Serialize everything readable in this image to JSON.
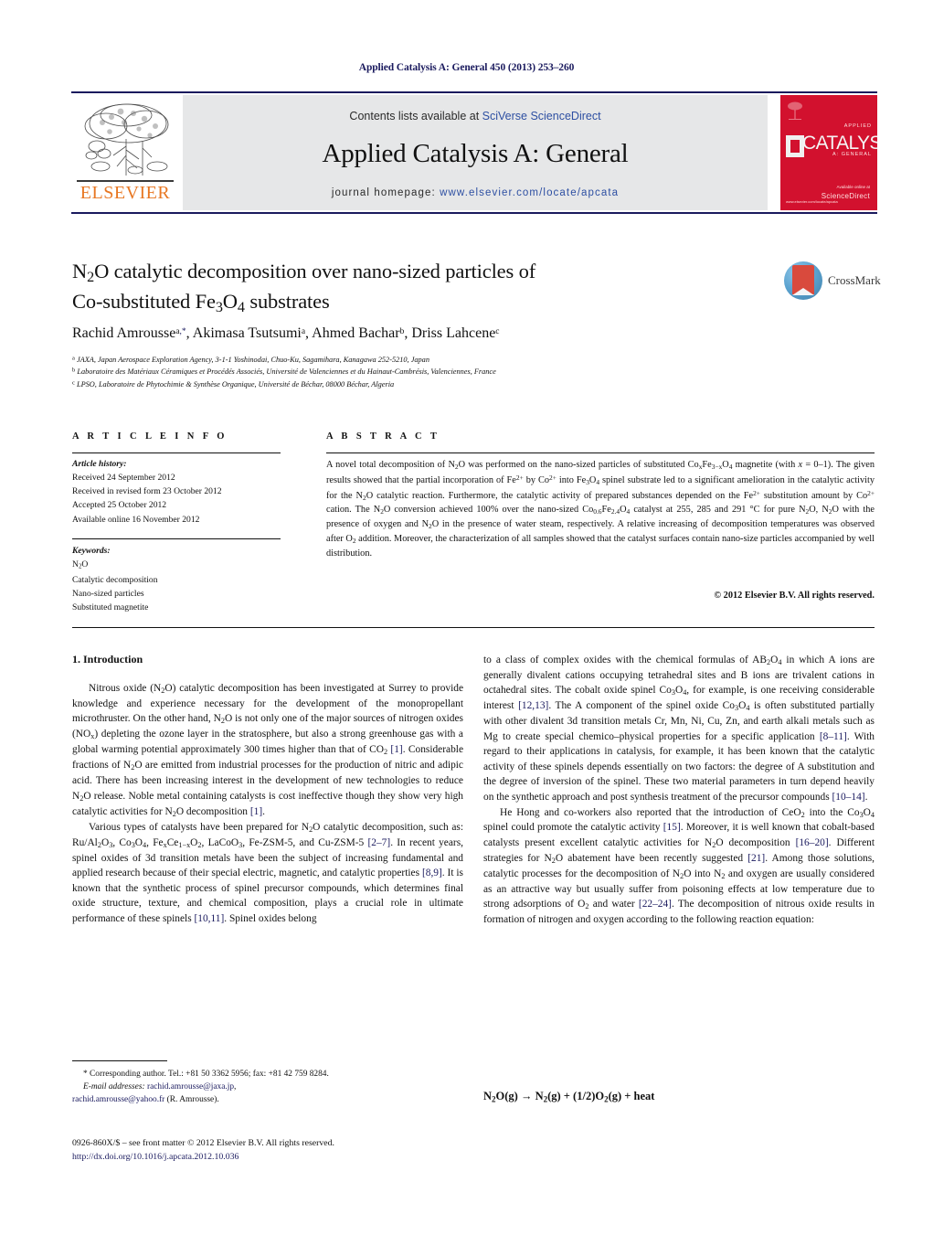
{
  "running_head": "Applied Catalysis A: General 450 (2013) 253–260",
  "masthead": {
    "contents_prefix": "Contents lists available at ",
    "contents_link": "SciVerse ScienceDirect",
    "journal_title": "Applied Catalysis A: General",
    "homepage_prefix": "journal homepage: ",
    "homepage_url": "www.elsevier.com/locate/apcata",
    "publisher_logo_text": "ELSEVIER",
    "cover": {
      "title": "CATALYSIS",
      "sup_top": "APPLIED",
      "sup_bottom": "A: GENERAL",
      "brand_big": "ScienceDirect",
      "brand_small": "Available online at",
      "footer": "www.elsevier.com/locate/apcata"
    }
  },
  "article": {
    "title_line1": "N2O catalytic decomposition over nano-sized particles of",
    "title_line2": "Co-substituted Fe3O4 substrates",
    "authors_plain": "Rachid Amrousse a,*, Akimasa Tsutsumi a, Ahmed Bachar b, Driss Lahcene c",
    "affiliations": [
      {
        "marker": "a",
        "text": "JAXA, Japan Aerospace Exploration Agency, 3-1-1 Yoshinodai, Chuo-Ku, Sagamihara, Kanagawa 252-5210, Japan"
      },
      {
        "marker": "b",
        "text": "Laboratoire des Matériaux Céramiques et Procédés Associés, Université de Valenciennes et du Hainaut-Cambrésis, Valenciennes, France"
      },
      {
        "marker": "c",
        "text": "LPSO, Laboratoire de Phytochimie & Synthèse Organique, Université de Béchar, 08000 Béchar, Algeria"
      }
    ],
    "crossmark_label": "CrossMark"
  },
  "article_info": {
    "heading": "A R T I C L E   I N F O",
    "history_label": "Article history:",
    "history": [
      "Received 24 September 2012",
      "Received in revised form 23 October 2012",
      "Accepted 25 October 2012",
      "Available online 16 November 2012"
    ],
    "keywords_label": "Keywords:",
    "keywords": [
      "N2O",
      "Catalytic decomposition",
      "Nano-sized particles",
      "Substituted magnetite"
    ]
  },
  "abstract": {
    "heading": "A B S T R A C T",
    "text": "A novel total decomposition of N2O was performed on the nano-sized particles of substituted CoxFe3−xO4 magnetite (with x = 0–1). The given results showed that the partial incorporation of Fe2+ by Co2+ into Fe3O4 spinel substrate led to a significant amelioration in the catalytic activity for the N2O catalytic reaction. Furthermore, the catalytic activity of prepared substances depended on the Fe2+ substitution amount by Co2+ cation. The N2O conversion achieved 100% over the nano-sized Co0.6Fe2.4O4 catalyst at 255, 285 and 291 °C for pure N2O, N2O with the presence of oxygen and N2O in the presence of water steam, respectively. A relative increasing of decomposition temperatures was observed after O2 addition. Moreover, the characterization of all samples showed that the catalyst surfaces contain nano-size particles accompanied by well distribution.",
    "copyright": "© 2012 Elsevier B.V. All rights reserved."
  },
  "body": {
    "intro_heading": "1. Introduction",
    "left_paragraphs": [
      "Nitrous oxide (N2O) catalytic decomposition has been investigated at Surrey to provide knowledge and experience necessary for the development of the monopropellant microthruster. On the other hand, N2O is not only one of the major sources of nitrogen oxides (NOx) depleting the ozone layer in the stratosphere, but also a strong greenhouse gas with a global warming potential approximately 300 times higher than that of CO2 [1]. Considerable fractions of N2O are emitted from industrial processes for the production of nitric and adipic acid. There has been increasing interest in the development of new technologies to reduce N2O release. Noble metal containing catalysts is cost ineffective though they show very high catalytic activities for N2O decomposition [1].",
      "Various types of catalysts have been prepared for N2O catalytic decomposition, such as: Ru/Al2O3, Co3O4, FexCe1−xO2, LaCoO3, Fe-ZSM-5, and Cu-ZSM-5 [2–7]. In recent years, spinel oxides of 3d transition metals have been the subject of increasing fundamental and applied research because of their special electric, magnetic, and catalytic properties [8,9]. It is known that the synthetic process of spinel precursor compounds, which determines final oxide structure, texture, and chemical composition, plays a crucial role in ultimate performance of these spinels [10,11]. Spinel oxides belong"
    ],
    "right_paragraphs": [
      "to a class of complex oxides with the chemical formulas of AB2O4 in which A ions are generally divalent cations occupying tetrahedral sites and B ions are trivalent cations in octahedral sites. The cobalt oxide spinel Co3O4, for example, is one receiving considerable interest [12,13]. The A component of the spinel oxide Co3O4 is often substituted partially with other divalent 3d transition metals Cr, Mn, Ni, Cu, Zn, and earth alkali metals such as Mg to create special chemico–physical properties for a specific application [8–11]. With regard to their applications in catalysis, for example, it has been known that the catalytic activity of these spinels depends essentially on two factors: the degree of A substitution and the degree of inversion of the spinel. These two material parameters in turn depend heavily on the synthetic approach and post synthesis treatment of the precursor compounds [10–14].",
      "He Hong and co-workers also reported that the introduction of CeO2 into the Co3O4 spinel could promote the catalytic activity [15]. Moreover, it is well known that cobalt-based catalysts present excellent catalytic activities for N2O decomposition [16–20]. Different strategies for N2O abatement have been recently suggested [21]. Among those solutions, catalytic processes for the decomposition of N2O into N2 and oxygen are usually considered as an attractive way but usually suffer from poisoning effects at low temperature due to strong adsorptions of O2 and water [22–24]. The decomposition of nitrous oxide results in formation of nitrogen and oxygen according to the following reaction equation:"
    ],
    "equation": "N2O(g) → N2(g) + (1/2)O2(g) + heat"
  },
  "footer": {
    "corresponding_line": "* Corresponding author. Tel.: +81 50 3362 5956; fax: +81 42 759 8284.",
    "email_label": "E-mail addresses:",
    "email1": "rachid.amrousse@jaxa.jp",
    "email2": "rachid.amrousse@yahoo.fr",
    "email_person": "(R. Amrousse).",
    "imprint": "0926-860X/$ – see front matter © 2012 Elsevier B.V. All rights reserved.",
    "doi": "http://dx.doi.org/10.1016/j.apcata.2012.10.036"
  }
}
